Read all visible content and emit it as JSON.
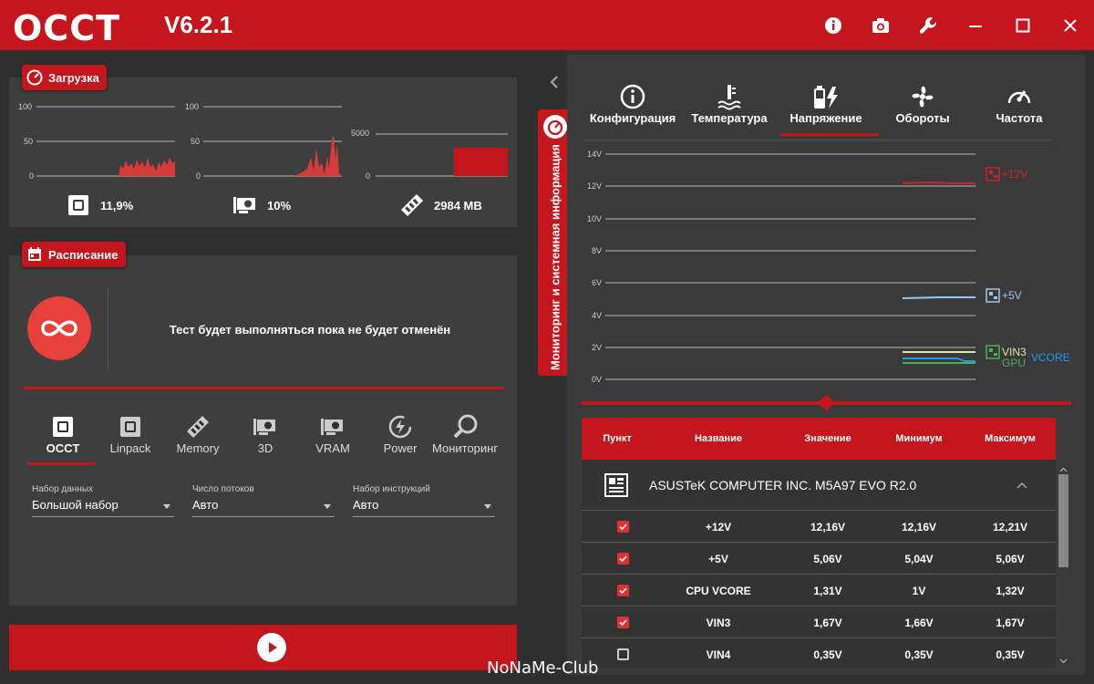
{
  "app": {
    "logo": "OCCT",
    "version": "V6.2.1"
  },
  "titlebar_icons": [
    "info-icon",
    "camera-icon",
    "wrench-icon",
    "minimize-icon",
    "maximize-icon",
    "close-icon"
  ],
  "load": {
    "title": "Загрузка",
    "cpu": {
      "axis": [
        "100",
        "50",
        "0"
      ],
      "value": "11,9%"
    },
    "gpu": {
      "axis": [
        "100",
        "50",
        "0"
      ],
      "value": "10%"
    },
    "ram": {
      "axis": [
        "5000",
        "0"
      ],
      "value": "2984 MB"
    }
  },
  "schedule": {
    "title": "Расписание",
    "message": "Тест будет выполняться пока не будет отменён",
    "tests": [
      {
        "label": "OCCT",
        "icon": "cpu-icon"
      },
      {
        "label": "Linpack",
        "icon": "cpu-icon"
      },
      {
        "label": "Memory",
        "icon": "memory-icon"
      },
      {
        "label": "3D",
        "icon": "gpu-icon"
      },
      {
        "label": "VRAM",
        "icon": "gpu-icon"
      },
      {
        "label": "Power",
        "icon": "power-icon"
      },
      {
        "label": "Мониторинг",
        "icon": "search-icon"
      }
    ],
    "fields": [
      {
        "label": "Набор данных",
        "value": "Большой набор"
      },
      {
        "label": "Число потоков",
        "value": "Авто"
      },
      {
        "label": "Набор инструкций",
        "value": "Авто"
      }
    ]
  },
  "monitoring": {
    "side_tab": "Мониторинг и системная информация",
    "tabs": [
      {
        "label": "Конфигурация",
        "icon": "info-icon"
      },
      {
        "label": "Температура",
        "icon": "thermometer-icon"
      },
      {
        "label": "Напряжение",
        "icon": "battery-bolt-icon"
      },
      {
        "label": "Обороты",
        "icon": "fan-icon"
      },
      {
        "label": "Частота",
        "icon": "gauge-icon"
      }
    ],
    "active_tab": "Напряжение",
    "chart_axis": [
      "14V",
      "12V",
      "10V",
      "8V",
      "6V",
      "4V",
      "2V",
      "0V"
    ],
    "series_labels": [
      "+12V",
      "+5V",
      "VIN3",
      "GPU",
      "VCORE"
    ],
    "colors": {
      "v12": "#d0202a",
      "v5": "#9ec6e8",
      "vin3": "#e8e0a0",
      "gpu": "#4caf50",
      "vcore": "#2196f3"
    }
  },
  "table": {
    "headers": [
      "Пункт",
      "Название",
      "Значение",
      "Минимум",
      "Максимум"
    ],
    "group": "ASUSTeK COMPUTER INC. M5A97 EVO R2.0",
    "rows": [
      {
        "name": "+12V",
        "value": "12,16V",
        "min": "12,16V",
        "max": "12,21V",
        "checked": true
      },
      {
        "name": "+5V",
        "value": "5,06V",
        "min": "5,04V",
        "max": "5,06V",
        "checked": true
      },
      {
        "name": "CPU VCORE",
        "value": "1,31V",
        "min": "1V",
        "max": "1,32V",
        "checked": true
      },
      {
        "name": "VIN3",
        "value": "1,67V",
        "min": "1,66V",
        "max": "1,67V",
        "checked": true
      },
      {
        "name": "VIN4",
        "value": "0,35V",
        "min": "0,35V",
        "max": "0,35V",
        "checked": false
      }
    ]
  },
  "watermark": "NoNaMe-Club",
  "accent": "#c4161c"
}
